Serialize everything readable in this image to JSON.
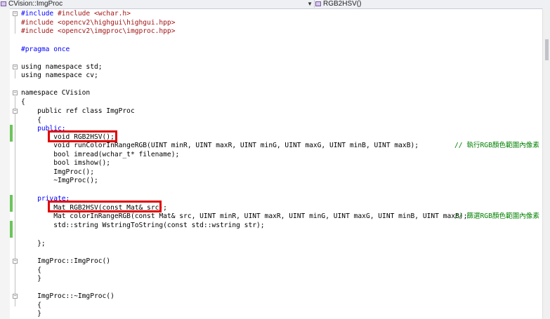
{
  "toolbar": {
    "left_dropdown": "CVision::ImgProc",
    "right_dropdown": "RGB2HSV()"
  },
  "code": {
    "l1": "#include <wchar.h>",
    "l2": "#include <opencv2\\highgui\\highgui.hpp>",
    "l3": "#include <opencv2\\imgproc\\imgproc.hpp>",
    "l5": "#pragma once",
    "l7": "using namespace std;",
    "l8": "using namespace cv;",
    "l10": "namespace CVision",
    "l11": "{",
    "l12": "    public ref class ImgProc",
    "l13": "    {",
    "l14": "    public:",
    "l15": "        void RGB2HSV();",
    "l16": "        void runColorInRangeRGB(UINT minR, UINT maxR, UINT minG, UINT maxG, UINT minB, UINT maxB);",
    "l16c": "// 執行RGB顏色範圍內像素",
    "l17": "        bool imread(wchar_t* filename);",
    "l18": "        bool imshow();",
    "l19": "        ImgProc();",
    "l20": "        ~ImgProc();",
    "l22": "    private:",
    "l23": "        Mat RGB2HSV(const Mat& src);",
    "l24": "        Mat colorInRangeRGB(const Mat& src, UINT minR, UINT maxR, UINT minG, UINT maxG, UINT minB, UINT maxB);",
    "l24c": "// 篩選RGB顏色範圍內像素",
    "l25": "        std::string WstringToString(const std::wstring str);",
    "l27": "    };",
    "l29": "    ImgProc::ImgProc()",
    "l30": "    {",
    "l31": "    }",
    "l33": "    ImgProc::~ImgProc()",
    "l34": "    {",
    "l35": "    }"
  },
  "colors": {
    "keyword": "#0000ff",
    "string": "#a31515",
    "type": "#2b91af",
    "comment": "#008000",
    "highlight_box": "#e00000",
    "change_marker": "#6cc55a"
  }
}
